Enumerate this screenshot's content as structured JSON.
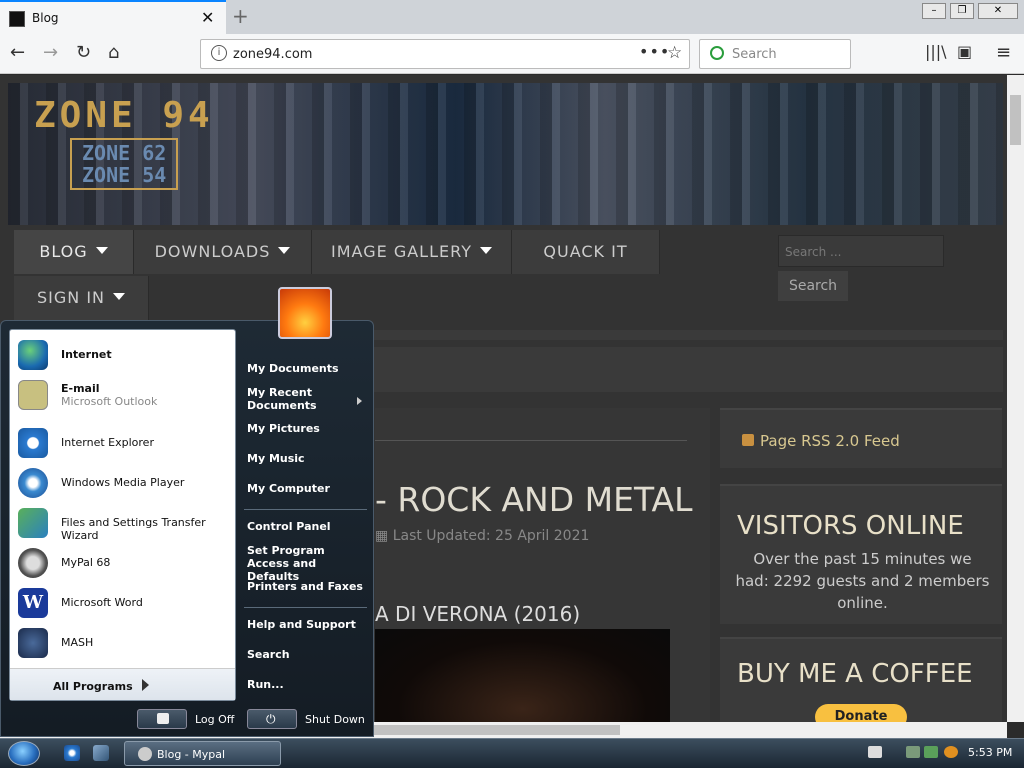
{
  "browser": {
    "tab_title": "Blog",
    "tab_close": "✕",
    "new_tab": "+",
    "url": "zone94.com",
    "search_placeholder": "Search",
    "page_actions": "•••"
  },
  "site": {
    "logo_main": "ZONE 94",
    "logo_sub1": "ZONE 62",
    "logo_sub2": "ZONE 54",
    "nav": [
      {
        "label": "BLOG"
      },
      {
        "label": "DOWNLOADS"
      },
      {
        "label": "IMAGE GALLERY"
      },
      {
        "label": "QUACK IT"
      },
      {
        "label": "SIGN IN"
      }
    ],
    "search_placeholder": "Search ...",
    "search_button": "Search",
    "article_title": "- ROCK AND METAL",
    "article_updated": "Last Updated: 25 April 2021",
    "article_sub": "A DI VERONA (2016)",
    "rss_label": "Page RSS 2.0 Feed",
    "visitors_title": "VISITORS ONLINE",
    "visitors_text": "Over the past 15 minutes we had: 2292 guests and 2 members online.",
    "coffee_title": "BUY ME A COFFEE",
    "donate": "Donate"
  },
  "start_menu": {
    "pinned": [
      {
        "label": "Internet",
        "bold": true
      },
      {
        "label": "E-mail",
        "sub": "Microsoft Outlook",
        "bold": true
      },
      {
        "label": "Internet Explorer"
      },
      {
        "label": "Windows Media Player"
      },
      {
        "label": "Files and Settings Transfer Wizard"
      },
      {
        "label": "MyPal 68"
      },
      {
        "label": "Microsoft Word"
      },
      {
        "label": "MASH"
      }
    ],
    "all_programs": "All Programs",
    "right": [
      "My Documents",
      "My Recent Documents",
      "My Pictures",
      "My Music",
      "My Computer",
      "Control Panel",
      "Set Program Access and Defaults",
      "Printers and Faxes",
      "Help and Support",
      "Search",
      "Run..."
    ],
    "log_off": "Log Off",
    "shut_down": "Shut Down"
  },
  "taskbar": {
    "task_label": "Blog - Mypal",
    "clock": "5:53 PM"
  }
}
